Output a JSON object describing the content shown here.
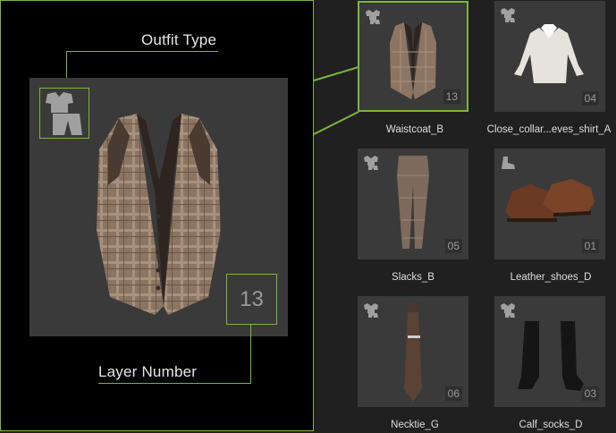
{
  "callouts": {
    "outfit_type": "Outfit Type",
    "layer_number": "Layer Number"
  },
  "preview": {
    "layer": "13",
    "item": "Waistcoat_B"
  },
  "items": [
    {
      "name": "Waistcoat_B",
      "layer": "13",
      "type_icon": "shirt-icon",
      "selected": true
    },
    {
      "name": "Close_collar...eves_shirt_A",
      "layer": "04",
      "type_icon": "shirt-icon",
      "selected": false
    },
    {
      "name": "Slacks_B",
      "layer": "05",
      "type_icon": "shirt-icon",
      "selected": false
    },
    {
      "name": "Leather_shoes_D",
      "layer": "01",
      "type_icon": "boot-icon",
      "selected": false
    },
    {
      "name": "Necktie_G",
      "layer": "06",
      "type_icon": "shirt-icon",
      "selected": false
    },
    {
      "name": "Calf_socks_D",
      "layer": "03",
      "type_icon": "shirt-icon",
      "selected": false
    }
  ],
  "colors": {
    "accent": "#7bb63a",
    "tile_bg": "#3a3a3a",
    "page_bg": "#202020"
  }
}
